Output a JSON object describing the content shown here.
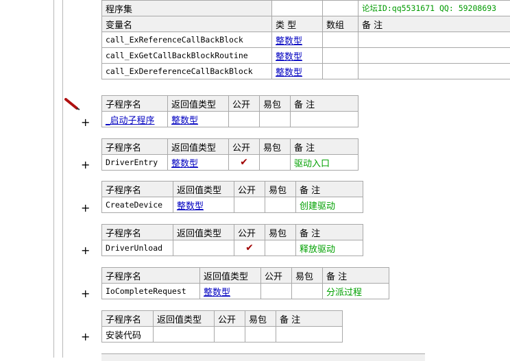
{
  "assembly": {
    "label": "程序集",
    "forum_id": "论坛ID:qq5531671 QQ: 59208693"
  },
  "var_header": {
    "name": "变量名",
    "type": "类 型",
    "array": "数组",
    "note": "备 注"
  },
  "variables": [
    {
      "name": "call_ExReferenceCallBackBlock",
      "type": "整数型"
    },
    {
      "name": "call_ExGetCallBackBlockRoutine",
      "type": "整数型"
    },
    {
      "name": "call_ExDereferenceCallBackBlock",
      "type": "整数型"
    }
  ],
  "sub_header": {
    "name": "子程序名",
    "ret": "返回值类型",
    "public": "公开",
    "easy": "易包",
    "note": "备 注"
  },
  "subs": [
    {
      "name": "_启动子程序",
      "ret": "整数型",
      "public": "",
      "note": ""
    },
    {
      "name": "DriverEntry",
      "ret": "整数型",
      "public": "✔",
      "note": "驱动入口"
    },
    {
      "name": "CreateDevice",
      "ret": "整数型",
      "public": "",
      "note": "创建驱动"
    },
    {
      "name": "DriverUnload",
      "ret": "",
      "public": "✔",
      "note": "释放驱动"
    },
    {
      "name": "IoCompleteRequest",
      "ret": "整数型",
      "public": "",
      "note": "分派过程"
    },
    {
      "name": "安装代码",
      "ret": "",
      "public": "",
      "note": ""
    }
  ],
  "expand_symbol": "+",
  "icons": {
    "pencil": "pencil-icon",
    "expand": "plus-icon"
  },
  "colors": {
    "type_link": "#0000c0",
    "note": "#00a000",
    "check": "#a00000",
    "header_bg": "#f0f0f0"
  }
}
